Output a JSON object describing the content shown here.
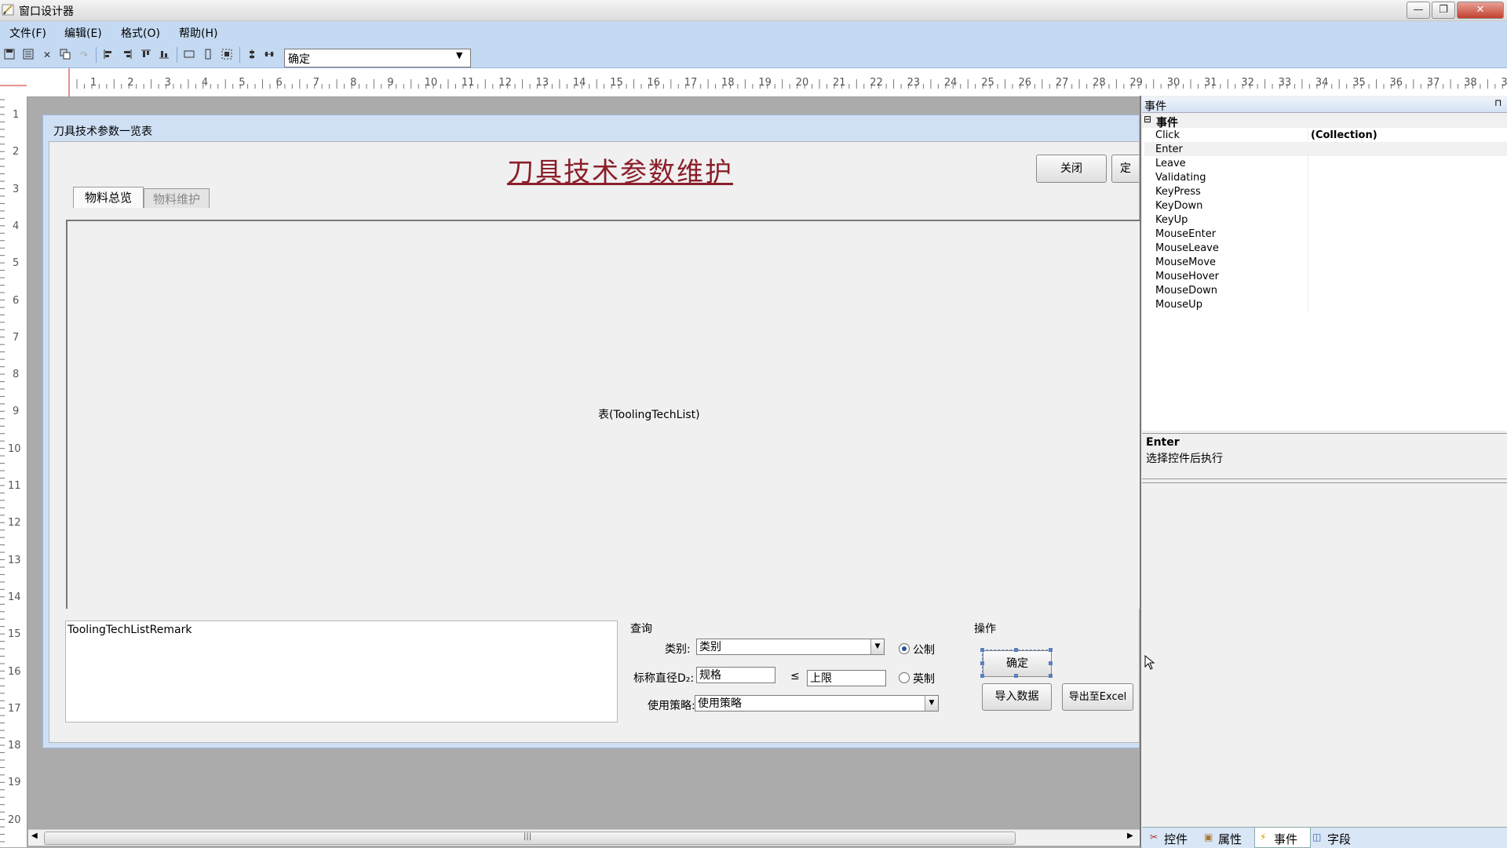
{
  "window": {
    "title": "窗口设计器",
    "minimize": "—",
    "restore": "❐",
    "close": "✕"
  },
  "menu": [
    "文件(F)",
    "编辑(E)",
    "格式(O)",
    "帮助(H)"
  ],
  "toolbar": {
    "combo_value": "确定"
  },
  "ruler": {
    "h": [
      "1",
      "2",
      "3",
      "4",
      "5",
      "6",
      "7",
      "8",
      "9",
      "10",
      "11",
      "12",
      "13",
      "14",
      "15",
      "16",
      "17",
      "18",
      "19",
      "20",
      "21",
      "22",
      "23",
      "24",
      "25",
      "26",
      "27",
      "28",
      "29",
      "30",
      "31",
      "32",
      "33",
      "34",
      "35",
      "36",
      "37",
      "38",
      "3"
    ],
    "v": [
      "1",
      "2",
      "3",
      "4",
      "5",
      "6",
      "7",
      "8",
      "9",
      "10",
      "11",
      "12",
      "13",
      "14",
      "15",
      "16",
      "17",
      "18",
      "19",
      "20"
    ]
  },
  "form": {
    "title": "刀具技术参数一览表",
    "heading": "刀具技术参数维护",
    "close_button": "关闭",
    "cut_button": "定",
    "tabs": [
      "物料总览",
      "物料维护"
    ],
    "grid_label": "表(ToolingTechList)",
    "remark": "ToolingTechListRemark",
    "query": {
      "group_label": "查询",
      "category_label": "类别:",
      "category_value": "类别",
      "diameter_label": "标称直径D₂:",
      "diameter_value": "规格",
      "le_symbol": "≤",
      "upper_value": "上限",
      "strategy_label": "使用策略:",
      "strategy_value": "使用策略",
      "metric_label": "公制",
      "imperial_label": "英制"
    },
    "ops": {
      "group_label": "操作",
      "confirm": "确定",
      "import": "导入数据",
      "export": "导出至Excel"
    }
  },
  "events_panel": {
    "title": "事件",
    "pin": "⊓",
    "category": "事件",
    "items": [
      {
        "name": "Click",
        "value": "(Collection)"
      },
      {
        "name": "Enter",
        "value": ""
      },
      {
        "name": "Leave",
        "value": ""
      },
      {
        "name": "Validating",
        "value": ""
      },
      {
        "name": "KeyPress",
        "value": ""
      },
      {
        "name": "KeyDown",
        "value": ""
      },
      {
        "name": "KeyUp",
        "value": ""
      },
      {
        "name": "MouseEnter",
        "value": ""
      },
      {
        "name": "MouseLeave",
        "value": ""
      },
      {
        "name": "MouseMove",
        "value": ""
      },
      {
        "name": "MouseHover",
        "value": ""
      },
      {
        "name": "MouseDown",
        "value": ""
      },
      {
        "name": "MouseUp",
        "value": ""
      }
    ],
    "desc_title": "Enter",
    "desc_text": "选择控件后执行",
    "bottom_tabs": [
      "控件",
      "属性",
      "事件",
      "字段"
    ]
  }
}
